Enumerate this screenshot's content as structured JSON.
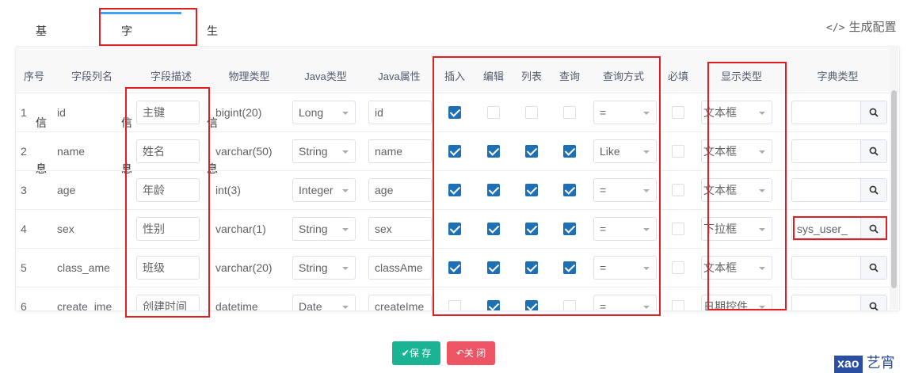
{
  "tabs": [
    {
      "label": "基本信息"
    },
    {
      "label": "字段信息"
    },
    {
      "label": "生成信息"
    }
  ],
  "gen_config": {
    "icon": "</>",
    "label": "生成配置"
  },
  "table": {
    "headers": [
      "序号",
      "字段列名",
      "字段描述",
      "物理类型",
      "Java类型",
      "Java属性",
      "插入",
      "编辑",
      "列表",
      "查询",
      "查询方式",
      "必填",
      "显示类型",
      "字典类型"
    ],
    "rows": [
      {
        "index": "1",
        "column": "id",
        "desc": "主键",
        "phys": "bigint(20)",
        "java_type": "Long",
        "java_field": "id",
        "insert": true,
        "edit": false,
        "list": false,
        "query": false,
        "query_type": "=",
        "required": false,
        "html_type": "文本框",
        "dict": ""
      },
      {
        "index": "2",
        "column": "name",
        "desc": "姓名",
        "phys": "varchar(50)",
        "java_type": "String",
        "java_field": "name",
        "insert": true,
        "edit": true,
        "list": true,
        "query": true,
        "query_type": "Like",
        "required": false,
        "html_type": "文本框",
        "dict": ""
      },
      {
        "index": "3",
        "column": "age",
        "desc": "年龄",
        "phys": "int(3)",
        "java_type": "Integer",
        "java_field": "age",
        "insert": true,
        "edit": true,
        "list": true,
        "query": true,
        "query_type": "=",
        "required": false,
        "html_type": "文本框",
        "dict": ""
      },
      {
        "index": "4",
        "column": "sex",
        "desc": "性别",
        "phys": "varchar(1)",
        "java_type": "String",
        "java_field": "sex",
        "insert": true,
        "edit": true,
        "list": true,
        "query": true,
        "query_type": "=",
        "required": false,
        "html_type": "下拉框",
        "dict": "sys_user_"
      },
      {
        "index": "5",
        "column": "class_ame",
        "desc": "班级",
        "phys": "varchar(20)",
        "java_type": "String",
        "java_field": "classAme",
        "insert": true,
        "edit": true,
        "list": true,
        "query": true,
        "query_type": "=",
        "required": false,
        "html_type": "文本框",
        "dict": ""
      },
      {
        "index": "6",
        "column": "create_ime",
        "desc": "创建时间",
        "phys": "datetime",
        "java_type": "Date",
        "java_field": "createIme",
        "insert": false,
        "edit": true,
        "list": true,
        "query": false,
        "query_type": "=",
        "required": false,
        "html_type": "日期控件",
        "dict": ""
      }
    ]
  },
  "buttons": {
    "save": "保 存",
    "close": "关 闭"
  },
  "watermark": {
    "brand": "xao",
    "text": "艺宵"
  },
  "colors": {
    "primary": "#409eff",
    "checkbox": "#1f6fb7",
    "save": "#1ab394",
    "close": "#ed5565",
    "highlight": "#e02020"
  }
}
